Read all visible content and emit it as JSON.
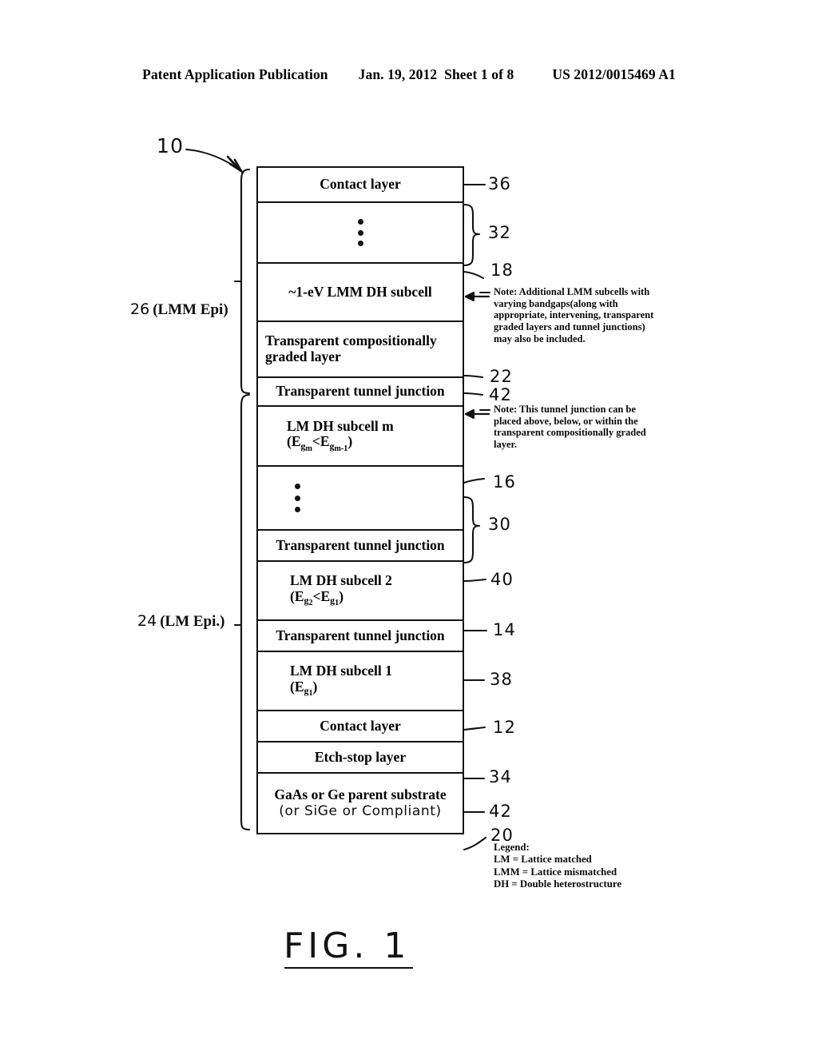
{
  "header": {
    "publication": "Patent Application Publication",
    "date_sheet": "Jan. 19, 2012  Sheet 1 of 8",
    "doc_number": "US 2012/0015469 A1"
  },
  "figure": {
    "caption": "FIG. 1",
    "lead_ref": "10"
  },
  "layers": [
    {
      "id": "contact-layer-top",
      "label": "Contact layer",
      "ref": "36",
      "align": "center"
    },
    {
      "id": "upper-ellipsis",
      "label": "",
      "ref": "32",
      "align": "dots"
    },
    {
      "id": "lmm-dh-subcell",
      "label": "~1-eV LMM DH subcell",
      "ref": "18",
      "align": "center"
    },
    {
      "id": "graded-layer",
      "label": "Transparent compositionally graded layer",
      "ref": "22",
      "align": "left"
    },
    {
      "id": "tunnel-junction-top",
      "label": "Transparent tunnel junction",
      "ref": "42",
      "align": "center"
    },
    {
      "id": "lm-dh-subcell-m",
      "label": "LM DH subcell m",
      "sub_label": "(Egm<Egm-1)",
      "ref": "16",
      "align": "center"
    },
    {
      "id": "lower-ellipsis",
      "label": "",
      "ref": "30",
      "align": "dots"
    },
    {
      "id": "tunnel-junction-40",
      "label": "Transparent tunnel junction",
      "ref": "40",
      "align": "center"
    },
    {
      "id": "lm-dh-subcell-2",
      "label": "LM DH subcell 2",
      "sub_label": "(Eg2<Eg1)",
      "ref": "14",
      "align": "center"
    },
    {
      "id": "tunnel-junction-38",
      "label": "Transparent tunnel junction",
      "ref": "38",
      "align": "center"
    },
    {
      "id": "lm-dh-subcell-1",
      "label": "LM DH subcell 1",
      "sub_label": "(Eg1)",
      "ref": "12",
      "align": "center"
    },
    {
      "id": "contact-layer-bottom",
      "label": "Contact layer",
      "ref": "34",
      "align": "center"
    },
    {
      "id": "etch-stop-layer",
      "label": "Etch-stop layer",
      "ref": "42",
      "align": "center"
    },
    {
      "id": "parent-substrate",
      "label": "GaAs or Ge parent substrate",
      "hand_label": "(or SiGe or Compliant)",
      "ref": "20",
      "align": "center"
    }
  ],
  "refs": {
    "r36": "36",
    "r32": "32",
    "r18": "18",
    "r22": "22",
    "r42a": "42",
    "r16": "16",
    "r30": "30",
    "r40": "40",
    "r14": "14",
    "r38": "38",
    "r12": "12",
    "r34": "34",
    "r42b": "42",
    "r20": "20"
  },
  "side_labels": {
    "lmm_epi": {
      "num": "26",
      "text": "(LMM Epi)"
    },
    "lm_epi": {
      "num": "24",
      "text": "(LM Epi.)"
    }
  },
  "notes": {
    "note1": {
      "head": "Note:",
      "body": "  Additional LMM subcells with varying bandgaps(along with appropriate, intervening, transparent graded layers and tunnel junctions) may also be included."
    },
    "note2": {
      "head": "Note:",
      "body": "  This tunnel junction can be placed above, below, or within the transparent compositionally graded layer."
    }
  },
  "legend": {
    "title": "Legend:",
    "lines": [
      "LM = Lattice matched",
      "LMM = Lattice mismatched",
      "DH = Double heterostructure"
    ]
  },
  "formulas": {
    "f_m": {
      "prefix": "(E",
      "s1": "g",
      "s2": "m",
      "mid": "<E",
      "s3": "g",
      "s4": "m-1",
      "suffix": ")"
    },
    "f_2": {
      "prefix": "(E",
      "s1": "g",
      "s2": "2",
      "mid": "<E",
      "s3": "g",
      "s4": "1",
      "suffix": ")"
    },
    "f_1": {
      "prefix": "(E",
      "s1": "g",
      "s2": "1",
      "suffix": ")"
    }
  }
}
